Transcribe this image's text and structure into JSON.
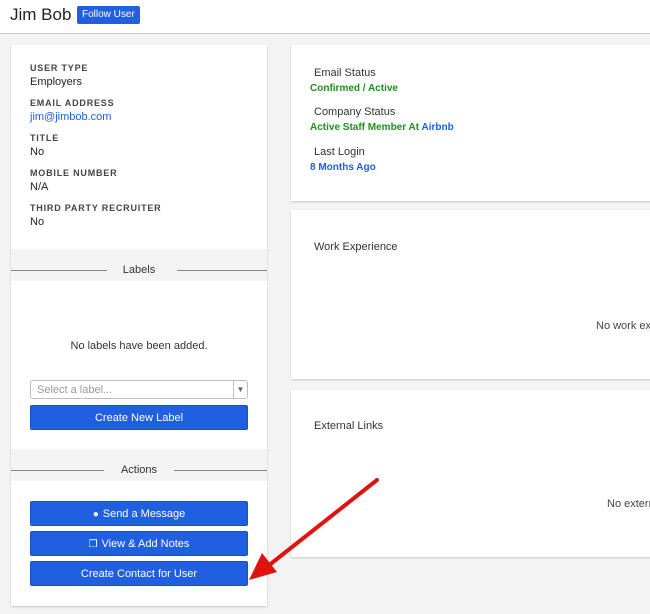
{
  "header": {
    "title": "Jim Bob",
    "follow_label": "Follow User"
  },
  "profile": {
    "fields": [
      {
        "label": "USER TYPE",
        "value": "Employers"
      },
      {
        "label": "EMAIL ADDRESS",
        "value": "jim@jimbob.com"
      },
      {
        "label": "TITLE",
        "value": "No"
      },
      {
        "label": "MOBILE NUMBER",
        "value": "N/A"
      },
      {
        "label": "THIRD PARTY RECRUITER",
        "value": "No"
      }
    ]
  },
  "labels_section": {
    "title": "Labels",
    "empty_text": "No labels have been added.",
    "select_placeholder": "Select a label...",
    "create_button": "Create New Label"
  },
  "actions_section": {
    "title": "Actions",
    "send_message": "Send a Message",
    "view_notes": "View & Add Notes",
    "create_contact": "Create Contact for User"
  },
  "status_card": {
    "email_status_label": "Email Status",
    "email_status_value": "Confirmed / Active",
    "company_status_label": "Company Status",
    "company_status_prefix": "Active Staff Member At",
    "company_name": "Airbnb",
    "last_login_label": "Last Login",
    "last_login_value": "8 Months Ago"
  },
  "work_experience": {
    "title": "Work Experience",
    "empty_text": "No work ex"
  },
  "external_links": {
    "title": "External Links",
    "empty_text": "No extern"
  },
  "colors": {
    "primary": "#1f5fe0",
    "success": "#1f8f1f",
    "annotation_arrow": "#e0140f"
  }
}
